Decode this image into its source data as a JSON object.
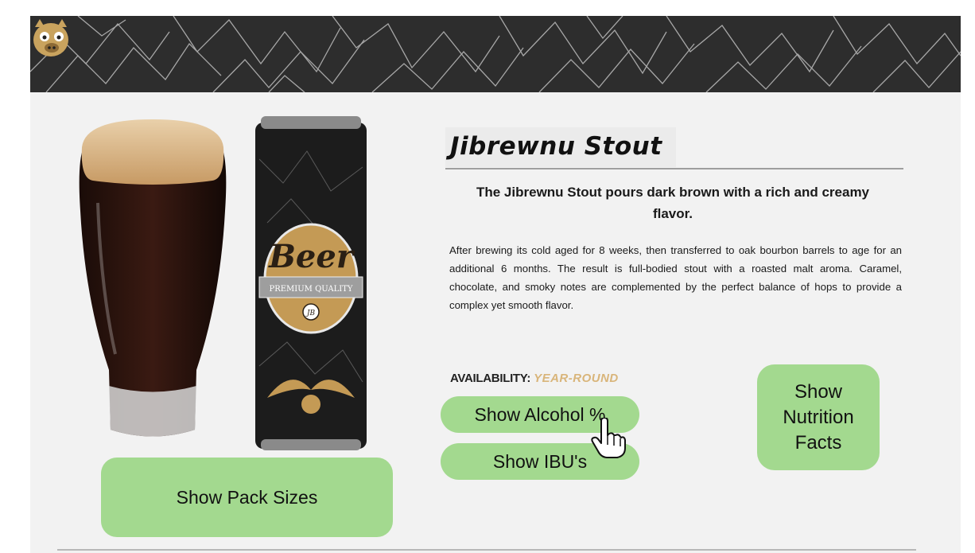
{
  "header": {
    "mascot_icon": "pig-mascot-logo"
  },
  "product": {
    "can_label_main": "Beer",
    "can_label_ribbon": "PREMIUM QUALITY",
    "can_label_badge": "JB",
    "title": "Jibrewnu Stout",
    "subheading": "The Jibrewnu Stout pours dark brown with a rich and creamy flavor.",
    "description": "After brewing its cold aged for 8 weeks, then transferred to oak bourbon barrels to age for an additional 6 months. The result is full-bodied stout with a roasted malt aroma. Caramel, chocolate, and smoky notes are complemented by the perfect balance of hops to provide a complex yet smooth flavor.",
    "availability_label": "AVAILABILITY:",
    "availability_value": "YEAR-ROUND"
  },
  "buttons": {
    "alcohol": "Show Alcohol %",
    "ibu": "Show IBU's",
    "nutrition": "Show Nutrition Facts",
    "pack_sizes": "Show Pack Sizes"
  },
  "colors": {
    "button_green": "#a3d98f",
    "header_dark": "#2d2d2d",
    "availability_gold": "#d9b57a"
  },
  "icons": {
    "cursor": "hand-pointer-icon"
  }
}
